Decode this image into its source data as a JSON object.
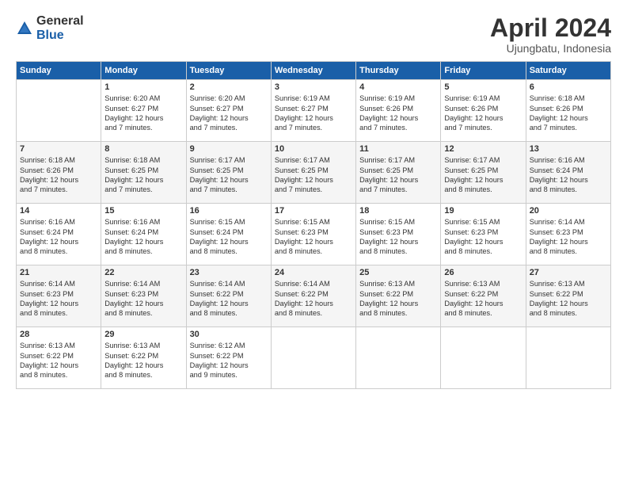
{
  "logo": {
    "general": "General",
    "blue": "Blue"
  },
  "title": "April 2024",
  "subtitle": "Ujungbatu, Indonesia",
  "days": [
    "Sunday",
    "Monday",
    "Tuesday",
    "Wednesday",
    "Thursday",
    "Friday",
    "Saturday"
  ],
  "weeks": [
    [
      {
        "day": "",
        "info": ""
      },
      {
        "day": "1",
        "info": "Sunrise: 6:20 AM\nSunset: 6:27 PM\nDaylight: 12 hours\nand 7 minutes."
      },
      {
        "day": "2",
        "info": "Sunrise: 6:20 AM\nSunset: 6:27 PM\nDaylight: 12 hours\nand 7 minutes."
      },
      {
        "day": "3",
        "info": "Sunrise: 6:19 AM\nSunset: 6:27 PM\nDaylight: 12 hours\nand 7 minutes."
      },
      {
        "day": "4",
        "info": "Sunrise: 6:19 AM\nSunset: 6:26 PM\nDaylight: 12 hours\nand 7 minutes."
      },
      {
        "day": "5",
        "info": "Sunrise: 6:19 AM\nSunset: 6:26 PM\nDaylight: 12 hours\nand 7 minutes."
      },
      {
        "day": "6",
        "info": "Sunrise: 6:18 AM\nSunset: 6:26 PM\nDaylight: 12 hours\nand 7 minutes."
      }
    ],
    [
      {
        "day": "7",
        "info": "Sunrise: 6:18 AM\nSunset: 6:26 PM\nDaylight: 12 hours\nand 7 minutes."
      },
      {
        "day": "8",
        "info": "Sunrise: 6:18 AM\nSunset: 6:25 PM\nDaylight: 12 hours\nand 7 minutes."
      },
      {
        "day": "9",
        "info": "Sunrise: 6:17 AM\nSunset: 6:25 PM\nDaylight: 12 hours\nand 7 minutes."
      },
      {
        "day": "10",
        "info": "Sunrise: 6:17 AM\nSunset: 6:25 PM\nDaylight: 12 hours\nand 7 minutes."
      },
      {
        "day": "11",
        "info": "Sunrise: 6:17 AM\nSunset: 6:25 PM\nDaylight: 12 hours\nand 7 minutes."
      },
      {
        "day": "12",
        "info": "Sunrise: 6:17 AM\nSunset: 6:25 PM\nDaylight: 12 hours\nand 8 minutes."
      },
      {
        "day": "13",
        "info": "Sunrise: 6:16 AM\nSunset: 6:24 PM\nDaylight: 12 hours\nand 8 minutes."
      }
    ],
    [
      {
        "day": "14",
        "info": "Sunrise: 6:16 AM\nSunset: 6:24 PM\nDaylight: 12 hours\nand 8 minutes."
      },
      {
        "day": "15",
        "info": "Sunrise: 6:16 AM\nSunset: 6:24 PM\nDaylight: 12 hours\nand 8 minutes."
      },
      {
        "day": "16",
        "info": "Sunrise: 6:15 AM\nSunset: 6:24 PM\nDaylight: 12 hours\nand 8 minutes."
      },
      {
        "day": "17",
        "info": "Sunrise: 6:15 AM\nSunset: 6:23 PM\nDaylight: 12 hours\nand 8 minutes."
      },
      {
        "day": "18",
        "info": "Sunrise: 6:15 AM\nSunset: 6:23 PM\nDaylight: 12 hours\nand 8 minutes."
      },
      {
        "day": "19",
        "info": "Sunrise: 6:15 AM\nSunset: 6:23 PM\nDaylight: 12 hours\nand 8 minutes."
      },
      {
        "day": "20",
        "info": "Sunrise: 6:14 AM\nSunset: 6:23 PM\nDaylight: 12 hours\nand 8 minutes."
      }
    ],
    [
      {
        "day": "21",
        "info": "Sunrise: 6:14 AM\nSunset: 6:23 PM\nDaylight: 12 hours\nand 8 minutes."
      },
      {
        "day": "22",
        "info": "Sunrise: 6:14 AM\nSunset: 6:23 PM\nDaylight: 12 hours\nand 8 minutes."
      },
      {
        "day": "23",
        "info": "Sunrise: 6:14 AM\nSunset: 6:22 PM\nDaylight: 12 hours\nand 8 minutes."
      },
      {
        "day": "24",
        "info": "Sunrise: 6:14 AM\nSunset: 6:22 PM\nDaylight: 12 hours\nand 8 minutes."
      },
      {
        "day": "25",
        "info": "Sunrise: 6:13 AM\nSunset: 6:22 PM\nDaylight: 12 hours\nand 8 minutes."
      },
      {
        "day": "26",
        "info": "Sunrise: 6:13 AM\nSunset: 6:22 PM\nDaylight: 12 hours\nand 8 minutes."
      },
      {
        "day": "27",
        "info": "Sunrise: 6:13 AM\nSunset: 6:22 PM\nDaylight: 12 hours\nand 8 minutes."
      }
    ],
    [
      {
        "day": "28",
        "info": "Sunrise: 6:13 AM\nSunset: 6:22 PM\nDaylight: 12 hours\nand 8 minutes."
      },
      {
        "day": "29",
        "info": "Sunrise: 6:13 AM\nSunset: 6:22 PM\nDaylight: 12 hours\nand 8 minutes."
      },
      {
        "day": "30",
        "info": "Sunrise: 6:12 AM\nSunset: 6:22 PM\nDaylight: 12 hours\nand 9 minutes."
      },
      {
        "day": "",
        "info": ""
      },
      {
        "day": "",
        "info": ""
      },
      {
        "day": "",
        "info": ""
      },
      {
        "day": "",
        "info": ""
      }
    ]
  ]
}
